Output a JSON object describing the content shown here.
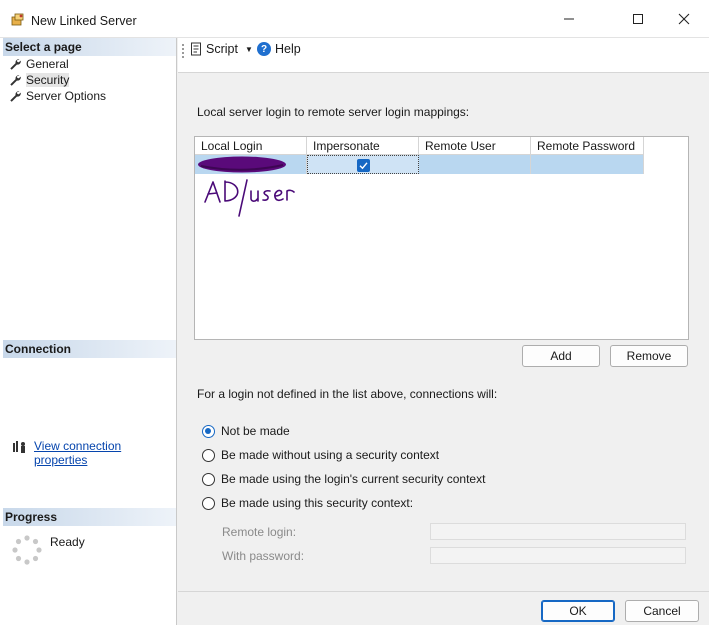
{
  "window": {
    "title": "New Linked Server"
  },
  "left_pane": {
    "select_page_header": "Select a page",
    "pages": [
      {
        "label": "General",
        "icon": "wrench-icon"
      },
      {
        "label": "Security",
        "icon": "wrench-icon",
        "selected": true
      },
      {
        "label": "Server Options",
        "icon": "wrench-icon"
      }
    ],
    "connection_header": "Connection",
    "view_connection_link": "View connection properties",
    "progress_header": "Progress",
    "progress_status": "Ready"
  },
  "toolbar": {
    "script_label": "Script",
    "help_label": "Help"
  },
  "mappings": {
    "label": "Local server login to remote server login mappings:",
    "columns": [
      "Local Login",
      "Impersonate",
      "Remote User",
      "Remote Password"
    ],
    "rows": [
      {
        "local_login": "",
        "impersonate": true,
        "remote_user": "",
        "remote_password": ""
      }
    ],
    "annotation": "AD/user",
    "add_label": "Add",
    "remove_label": "Remove"
  },
  "connections": {
    "label": "For a login not defined in the list above, connections will:",
    "options": [
      {
        "label": "Not be made",
        "selected": true
      },
      {
        "label": "Be made without using a security context",
        "selected": false
      },
      {
        "label": "Be made using the login's current security context",
        "selected": false
      },
      {
        "label": "Be made using this security context:",
        "selected": false
      }
    ],
    "remote_login_label": "Remote login:",
    "remote_login_value": "",
    "password_label": "With password:",
    "password_value": ""
  },
  "footer": {
    "ok_label": "OK",
    "cancel_label": "Cancel"
  },
  "colors": {
    "accent": "#1668c4",
    "selection": "#b9d7f0",
    "redaction": "#5a0a7a",
    "link": "#0645ad"
  }
}
